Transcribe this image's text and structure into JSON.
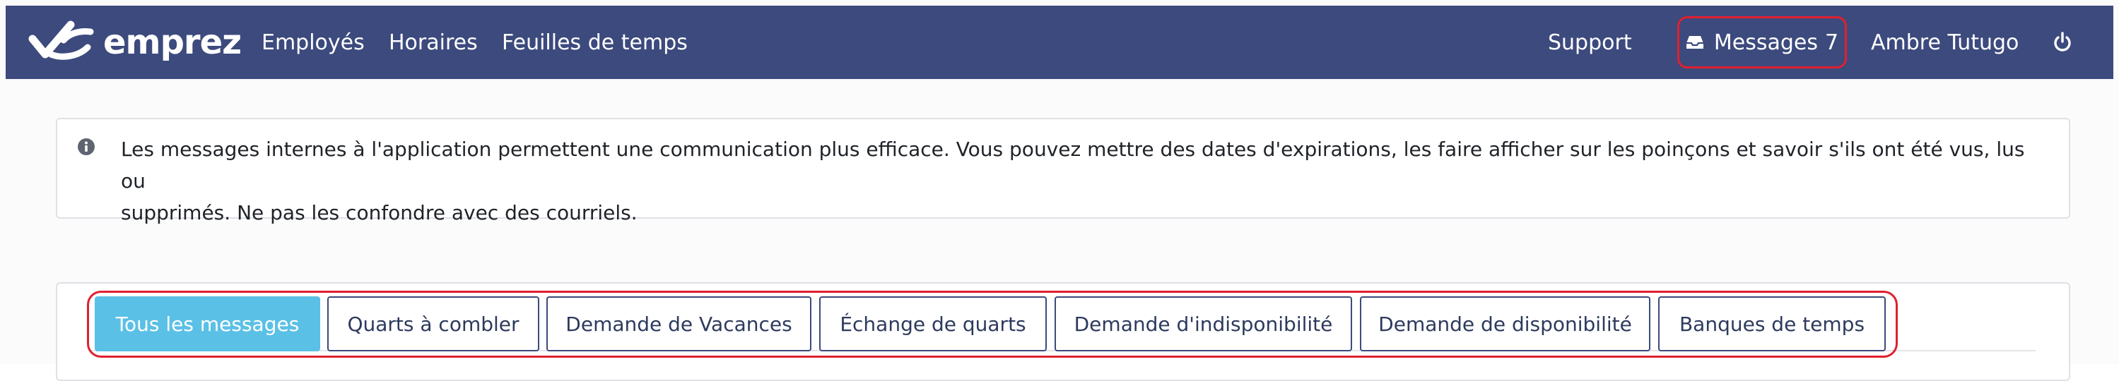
{
  "brand": {
    "name": "emprez"
  },
  "nav": {
    "links": [
      "Employés",
      "Horaires",
      "Feuilles de temps"
    ],
    "support": "Support",
    "messages_label": "Messages",
    "messages_count": "7",
    "user_name": "Ambre Tutugo"
  },
  "icons": {
    "logo": "emprez-logo-icon",
    "inbox": "inbox-icon",
    "power": "power-icon",
    "info": "info-icon"
  },
  "alert": {
    "line1": "Les messages internes à l'application permettent une communication plus efficace. Vous pouvez mettre des dates d'expirations, les faire afficher sur les poinçons et savoir s'ils ont été vus, lus ou",
    "line2": "supprimés. Ne pas les confondre avec des courriels."
  },
  "tabs": [
    "Tous les messages",
    "Quarts à combler",
    "Demande de Vacances",
    "Échange de quarts",
    "Demande d'indisponibilité",
    "Demande de disponibilité",
    "Banques de temps"
  ],
  "active_tab": "Tous les messages",
  "colors": {
    "navbar": "#3c4a7d",
    "active_tab": "#5bc0e6",
    "highlight": "#e0202e"
  }
}
